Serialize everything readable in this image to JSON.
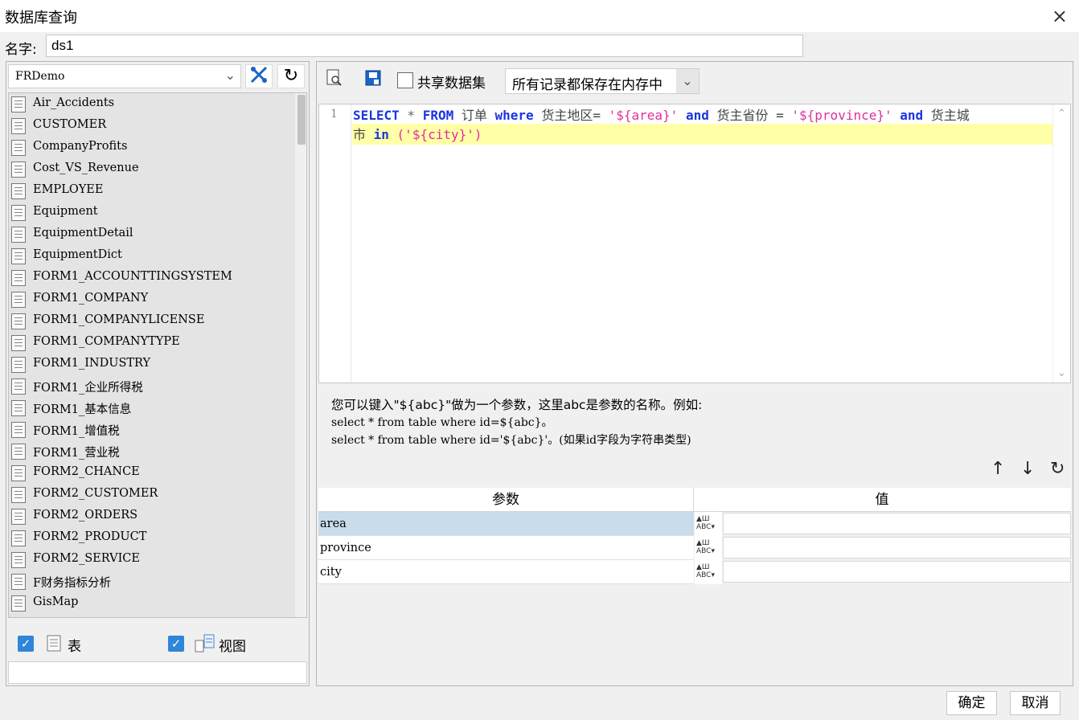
{
  "window": {
    "title": "数据库查询",
    "close_icon": "×"
  },
  "name_field": {
    "label": "名字:",
    "value": "ds1"
  },
  "connection": {
    "selected": "FRDemo"
  },
  "tables": [
    "Air_Accidents",
    "CUSTOMER",
    "CompanyProfits",
    "Cost_VS_Revenue",
    "EMPLOYEE",
    "Equipment",
    "EquipmentDetail",
    "EquipmentDict",
    "FORM1_ACCOUNTTINGSYSTEM",
    "FORM1_COMPANY",
    "FORM1_COMPANYLICENSE",
    "FORM1_COMPANYTYPE",
    "FORM1_INDUSTRY",
    "FORM1_企业所得税",
    "FORM1_基本信息",
    "FORM1_增值税",
    "FORM1_营业税",
    "FORM2_CHANCE",
    "FORM2_CUSTOMER",
    "FORM2_ORDERS",
    "FORM2_PRODUCT",
    "FORM2_SERVICE",
    "F财务指标分析",
    "GisMap"
  ],
  "filters": {
    "table_label": "表",
    "view_label": "视图",
    "table_checked": true,
    "view_checked": true
  },
  "toolbar": {
    "share_label": "共享数据集",
    "memory_option": "所有记录都保存在内存中"
  },
  "editor": {
    "line_number": "1",
    "sql": {
      "t1": "SELECT",
      "t2": " * ",
      "t3": "FROM",
      "t4": " 订单 ",
      "t5": "where",
      "t6": " 货主地区= ",
      "t7": "'${area}'",
      "t8": " ",
      "t9": "and",
      "t10": " 货主省份 = ",
      "t11": "'${province}'",
      "t12": " ",
      "t13": "and",
      "t14": " 货主城",
      "t15": "市 ",
      "t16": "in",
      "t17": " ",
      "t18": "('${city}')"
    }
  },
  "hint": {
    "line1": "您可以键入\"${abc}\"做为一个参数，这里abc是参数的名称。例如:",
    "line2": "select * from table where id=${abc}。",
    "line3": "select * from table where id='${abc}'。(如果id字段为字符串类型)"
  },
  "params": {
    "col_name": "参数",
    "col_value": "值",
    "rows": [
      {
        "name": "area",
        "value": ""
      },
      {
        "name": "province",
        "value": ""
      },
      {
        "name": "city",
        "value": ""
      }
    ]
  },
  "buttons": {
    "ok": "确定",
    "cancel": "取消"
  },
  "colors": {
    "keyword": "#1a35e0",
    "string": "#e02fa0",
    "highlight": "#ffffa8",
    "selected_row": "#c8dceb",
    "checkbox": "#2f86d8"
  }
}
